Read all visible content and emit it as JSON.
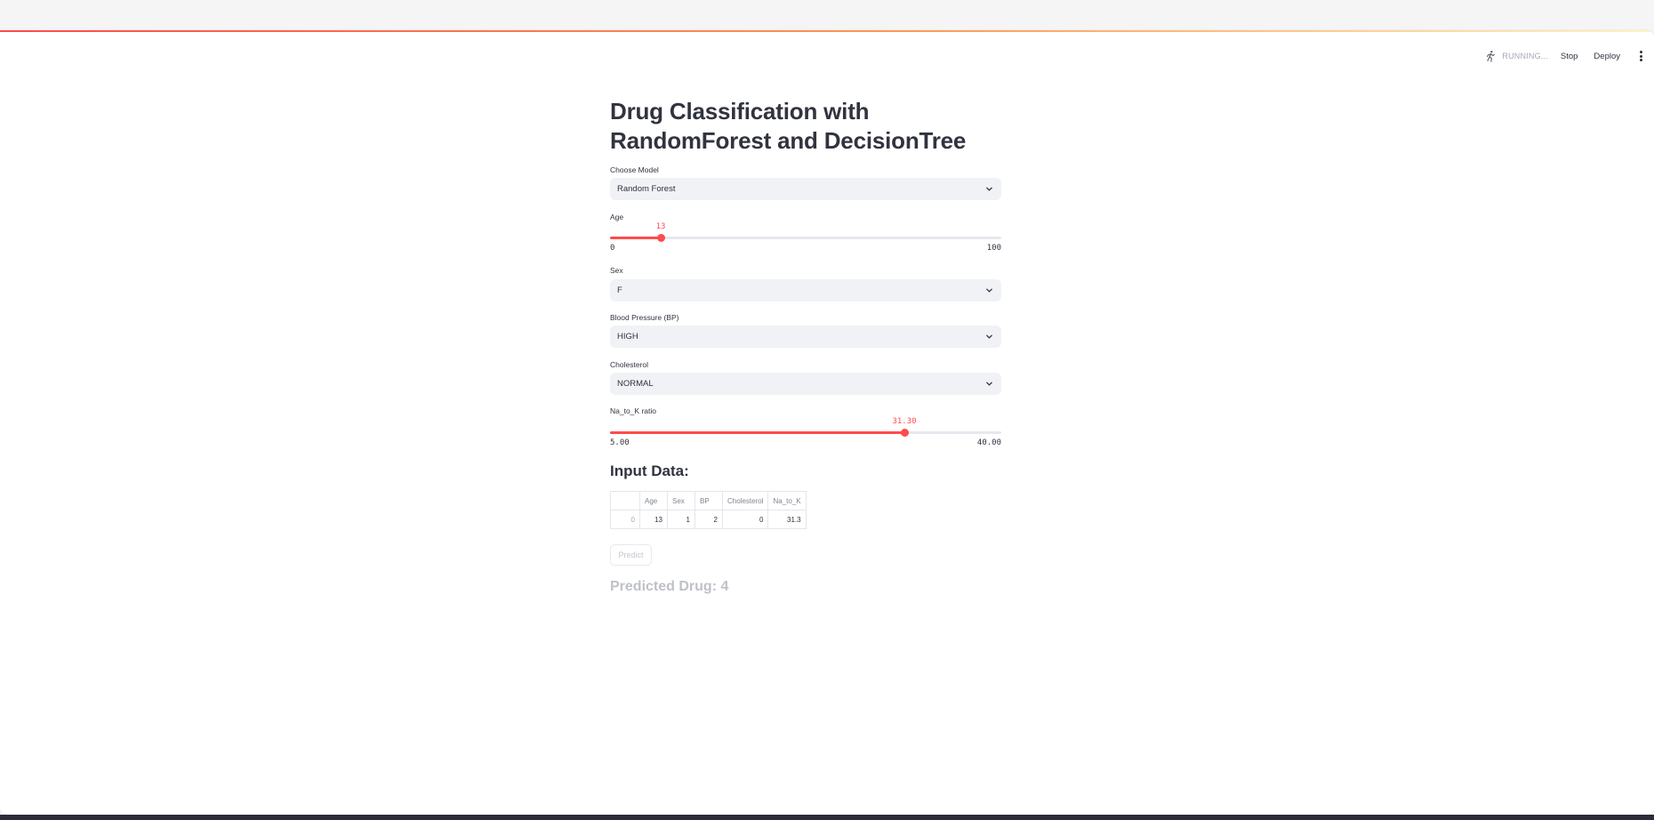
{
  "header": {
    "status": "RUNNING...",
    "stop_label": "Stop",
    "deploy_label": "Deploy",
    "menu_icon": "kebab-menu-icon",
    "running_icon": "running-man-icon"
  },
  "page": {
    "title": "Drug Classification with RandomForest and DecisionTree"
  },
  "model_select": {
    "label": "Choose Model",
    "value": "Random Forest"
  },
  "age_slider": {
    "label": "Age",
    "value": "13",
    "min": "0",
    "max": "100"
  },
  "sex_select": {
    "label": "Sex",
    "value": "F"
  },
  "bp_select": {
    "label": "Blood Pressure (BP)",
    "value": "HIGH"
  },
  "chol_select": {
    "label": "Cholesterol",
    "value": "NORMAL"
  },
  "na_k_slider": {
    "label": "Na_to_K ratio",
    "value": "31.30",
    "min": "5.00",
    "max": "40.00"
  },
  "input_data": {
    "heading": "Input Data:",
    "columns": [
      "",
      "Age",
      "Sex",
      "BP",
      "Cholesterol",
      "Na_to_K"
    ],
    "rows": [
      [
        "0",
        "13",
        "1",
        "2",
        "0",
        "31.3"
      ]
    ]
  },
  "predict_button": {
    "label": "Predict"
  },
  "result": {
    "text": "Predicted Drug: 4"
  },
  "colors": {
    "accent": "#ff4b4b",
    "text": "#31333f",
    "widget_bg": "#f0f2f6"
  }
}
